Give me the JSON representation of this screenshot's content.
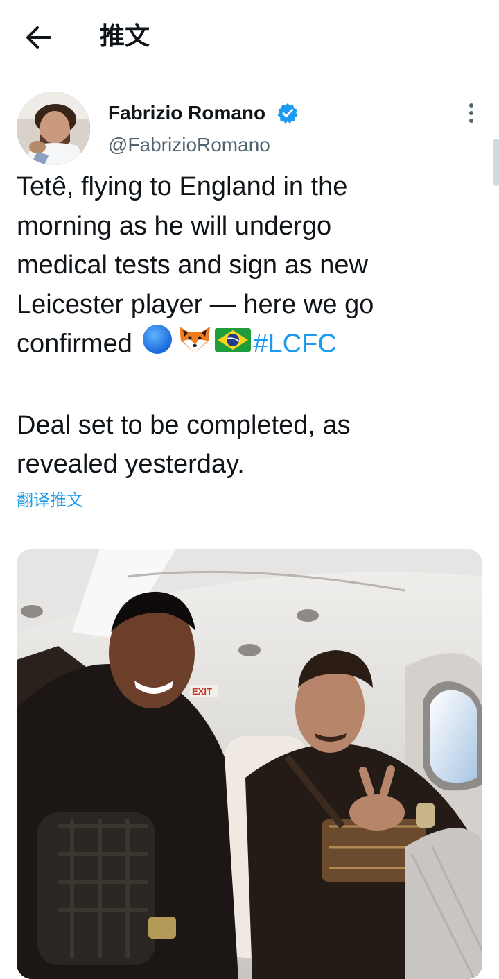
{
  "header": {
    "title": "推文",
    "back_icon": "arrow-left-icon"
  },
  "tweet": {
    "author": {
      "display_name": "Fabrizio Romano",
      "handle": "@FabrizioRomano",
      "verified": true
    },
    "text": {
      "part1": "Tetê, flying to England in the\nmorning as he will undergo\nmedical tests and sign as new\nLeicester player — here we go\nconfirmed ",
      "emojis": [
        "blue-circle-emoji",
        "fox-emoji",
        "brazil-flag-emoji"
      ],
      "hashtag": "#LCFC",
      "part2": "\n\nDeal set to be completed, as\nrevealed yesterday."
    },
    "translate_label": "翻译推文",
    "photo": {
      "sign_text": "EXIT"
    }
  },
  "colors": {
    "accent": "#1d9bf0",
    "text": "#0f1419",
    "secondary": "#536471"
  }
}
